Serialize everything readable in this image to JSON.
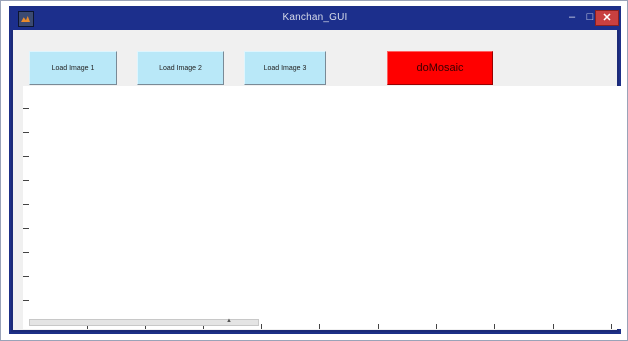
{
  "window": {
    "title": "Kanchan_GUI",
    "controls": {
      "minimize": "–",
      "maximize": "□",
      "close": "✕"
    },
    "icon": "matlab-figure-icon"
  },
  "buttons": {
    "load_image_1": "Load Image 1",
    "load_image_2": "Load Image 2",
    "load_image_3": "Load Image 3",
    "do_mosaic": "doMosaic"
  },
  "colors": {
    "load_button_bg": "#b9e8f8",
    "mosaic_button_bg": "#ff0000",
    "titlebar_bg": "#1c2f8c"
  },
  "axes": {
    "ytick_count": 10,
    "xtick_count": 10
  }
}
